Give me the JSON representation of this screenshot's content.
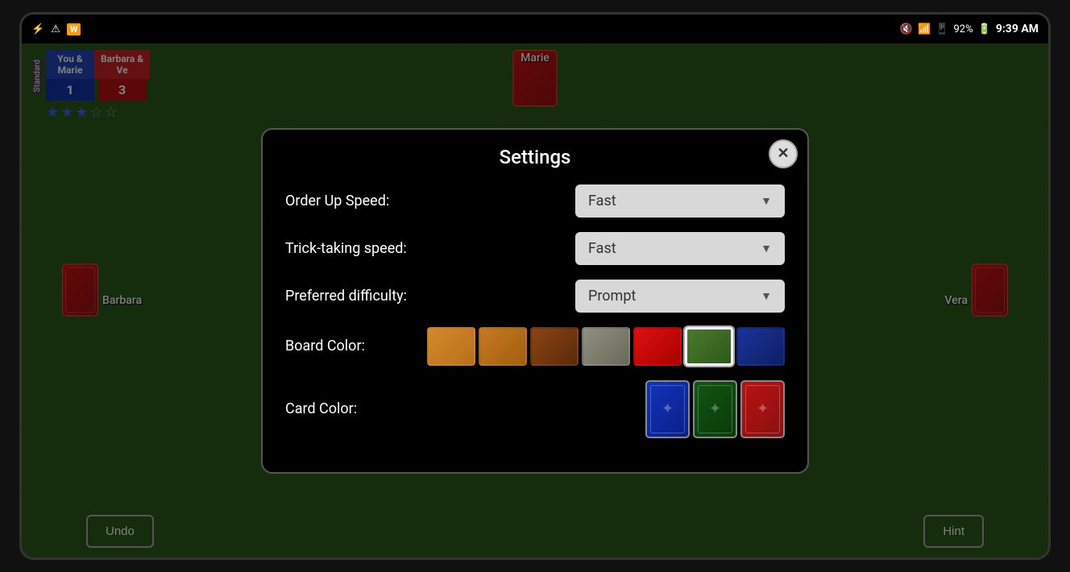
{
  "status_bar": {
    "time": "9:39 AM",
    "battery": "92%",
    "icons": [
      "usb-icon",
      "warning-icon",
      "word-icon",
      "mute-icon",
      "wifi-icon",
      "signal-icon",
      "battery-icon"
    ]
  },
  "game": {
    "player_top": "Marie",
    "player_left": "Barbara",
    "player_right": "Vera",
    "team1_name": "You &\nMarie",
    "team2_name": "Barbara &\nVe",
    "team1_score": "1",
    "team2_score": "3",
    "stars_filled": 3,
    "stars_total": 5,
    "undo_label": "Undo",
    "hint_label": "Hint"
  },
  "settings": {
    "title": "Settings",
    "close_label": "✕",
    "order_up_speed_label": "Order Up Speed:",
    "order_up_speed_value": "Fast",
    "trick_taking_speed_label": "Trick-taking speed:",
    "trick_taking_speed_value": "Fast",
    "preferred_difficulty_label": "Preferred difficulty:",
    "preferred_difficulty_value": "Prompt",
    "board_color_label": "Board Color:",
    "board_colors": [
      {
        "name": "light-wood",
        "color": "#c87820"
      },
      {
        "name": "medium-wood",
        "color": "#b86a10"
      },
      {
        "name": "dark-wood",
        "color": "#8b4513"
      },
      {
        "name": "gray-slate",
        "color": "#808070"
      },
      {
        "name": "red-felt",
        "color": "#cc1111"
      },
      {
        "name": "green-felt",
        "color": "#4a7a2a",
        "selected": true
      },
      {
        "name": "blue-felt",
        "color": "#1a3399"
      }
    ],
    "card_color_label": "Card Color:",
    "card_colors": [
      {
        "name": "blue-card"
      },
      {
        "name": "green-card"
      },
      {
        "name": "red-card"
      }
    ]
  }
}
